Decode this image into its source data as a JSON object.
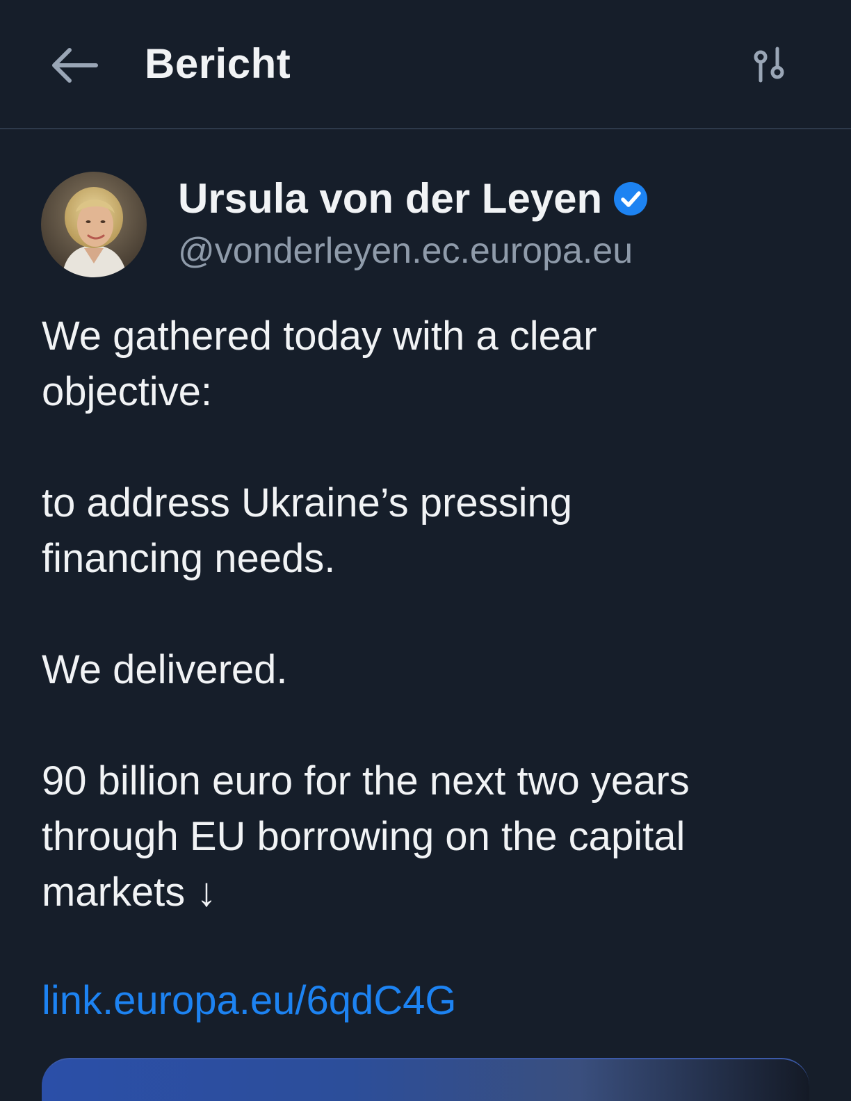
{
  "header": {
    "back_icon": "arrow-left-icon",
    "title": "Bericht",
    "settings_icon": "sliders-icon"
  },
  "post": {
    "author": {
      "name": "Ursula von der Leyen",
      "handle": "@vonderleyen.ec.europa.eu",
      "verified": true,
      "verified_color": "#1d83f2",
      "avatar_icon": "avatar-photo"
    },
    "body": {
      "p1": "We gathered today with a clear\nobjective:",
      "p2": "to address Ukraine’s pressing\nfinancing needs.",
      "p3": "We delivered.",
      "p4": "90 billion euro for the next two years\nthrough EU borrowing on the capital\nmarkets ↓"
    },
    "link": "link.europa.eu/6qdC4G",
    "link_color": "#1d83f2"
  },
  "colors": {
    "background": "#161e2a",
    "text": "#f1f3f5",
    "secondary_text": "#8f9baa"
  }
}
